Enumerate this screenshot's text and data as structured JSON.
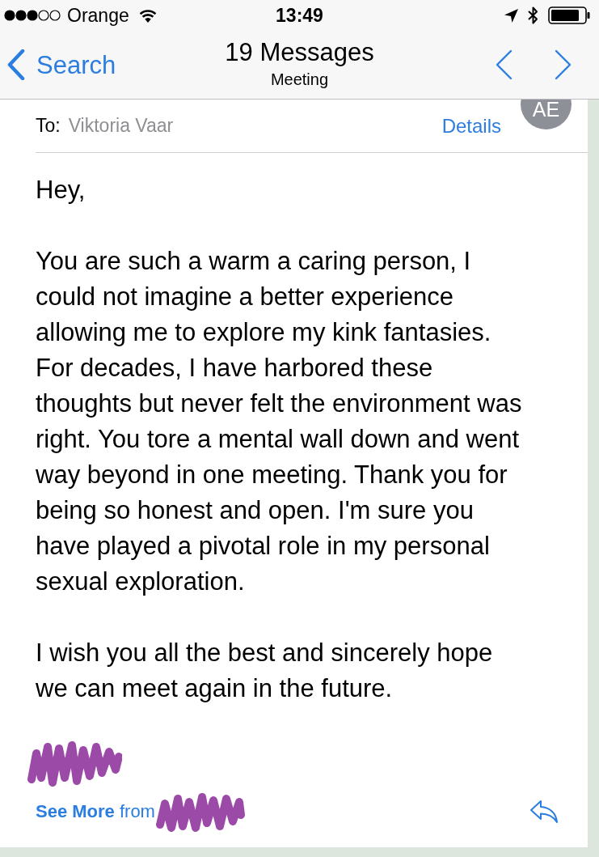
{
  "status_bar": {
    "carrier": "Orange",
    "time": "13:49"
  },
  "nav_bar": {
    "back_label": "Search",
    "title": "19 Messages",
    "subtitle": "Meeting"
  },
  "header": {
    "to_label": "To:",
    "recipient": "Viktoria Vaar",
    "details_link": "Details",
    "avatar_initials": "AE"
  },
  "body": {
    "greeting": "Hey,",
    "paragraphs": [
      "You are such a warm a caring person, I could not imagine a better experience allowing me to explore my kink fantasies. For decades, I have harbored these thoughts but never felt the environment was right. You tore a mental wall down and went way beyond in one meeting. Thank you for being so honest and open. I'm sure you have played a pivotal role in my personal sexual exploration.",
      "I wish you all the best and sincerely hope we can meet again in the future."
    ]
  },
  "footer": {
    "see_more": "**See More** from"
  }
}
